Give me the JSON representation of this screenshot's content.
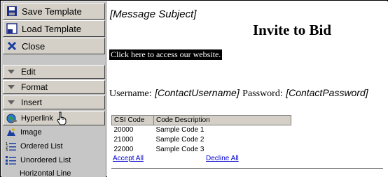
{
  "toolbar": {
    "save_label": "Save Template",
    "load_label": "Load Template",
    "close_label": "Close"
  },
  "sections": {
    "edit_label": "Edit",
    "format_label": "Format",
    "insert_label": "Insert"
  },
  "insert_items": {
    "hyperlink": "Hyperlink",
    "image": "Image",
    "ordered_list": "Ordered List",
    "unordered_list": "Unordered List",
    "horizontal_line": "Horizontal Line"
  },
  "document": {
    "subject": "[Message Subject]",
    "title": "Invite to Bid",
    "website_link": "Click here to access our website.",
    "username_label": "Username:",
    "username_value": "[ContactUsername]",
    "password_label": "Password:",
    "password_value": "[ContactPassword]",
    "table": {
      "headers": [
        "CSI Code",
        "Code Description"
      ],
      "rows": [
        [
          "20000",
          "Sample Code 1"
        ],
        [
          "21000",
          "Sample Code 2"
        ],
        [
          "22000",
          "Sample Code 3"
        ]
      ]
    },
    "accept_label": "Accept All",
    "decline_label": "Decline All"
  },
  "colors": {
    "sidebar_bg": "#c6c6c6",
    "button_face": "#d4d0c8",
    "link_blue": "#0000cc",
    "close_x_blue": "#1a3fa0"
  },
  "icons": {
    "save": "floppy-disk-icon",
    "load": "load-template-icon",
    "close": "close-x-icon",
    "hyperlink": "globe-link-icon",
    "image": "image-icon",
    "ordered_list": "ordered-list-icon",
    "unordered_list": "unordered-list-icon",
    "cursor": "hand-pointer-icon"
  }
}
